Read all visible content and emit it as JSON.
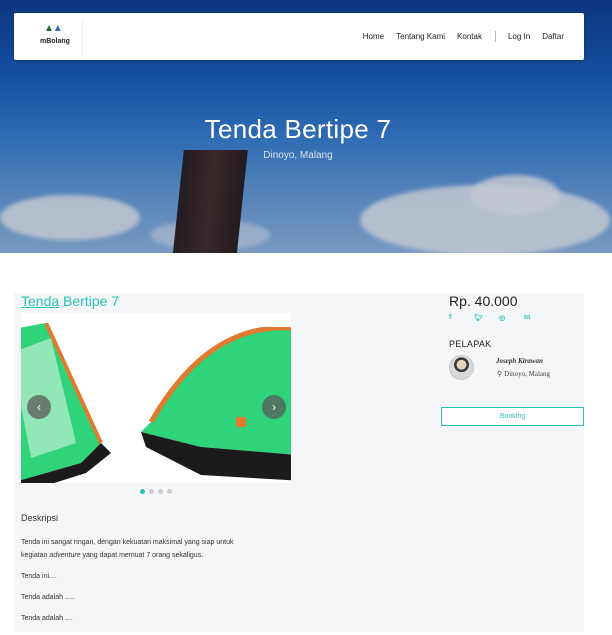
{
  "hero": {
    "title": "Tenda Bertipe 7",
    "location": "Dinoyo, Malang"
  },
  "navbar": {
    "logo_text": "mBolang",
    "links": [
      "Home",
      "Tentang Kami",
      "Kontak"
    ],
    "auth": [
      "Log In",
      "Daftar"
    ]
  },
  "product": {
    "title_link": "Tenda",
    "title_rest": " Bertipe 7",
    "price": "Rp. 40.000",
    "socials": [
      "f",
      "t",
      "ig",
      "in"
    ],
    "seller_label": "PELAPAK",
    "seller_name": "Joseph Kirawan",
    "seller_location": "Dinoyo,  Malang",
    "booking_label": "Booking",
    "slider_dots": 4,
    "slider_active": 0
  },
  "description": {
    "heading": "Deskripsi",
    "line1": "Tenda ini sangat ringan, dengan kekuatan maksimal yang siap untuk",
    "line2_pre": "kegiatan ",
    "line2_em": "adventure",
    "line2_post": " yang dapat memuat 7 orang sekaligus.",
    "p2": "Tenda ini....",
    "p3": "Tenda adalah .....",
    "p4": "Tenda adalah ...."
  },
  "colors": {
    "accent": "#2bc3b4",
    "tent_green": "#2ed37a",
    "tent_orange": "#e07a2e"
  }
}
